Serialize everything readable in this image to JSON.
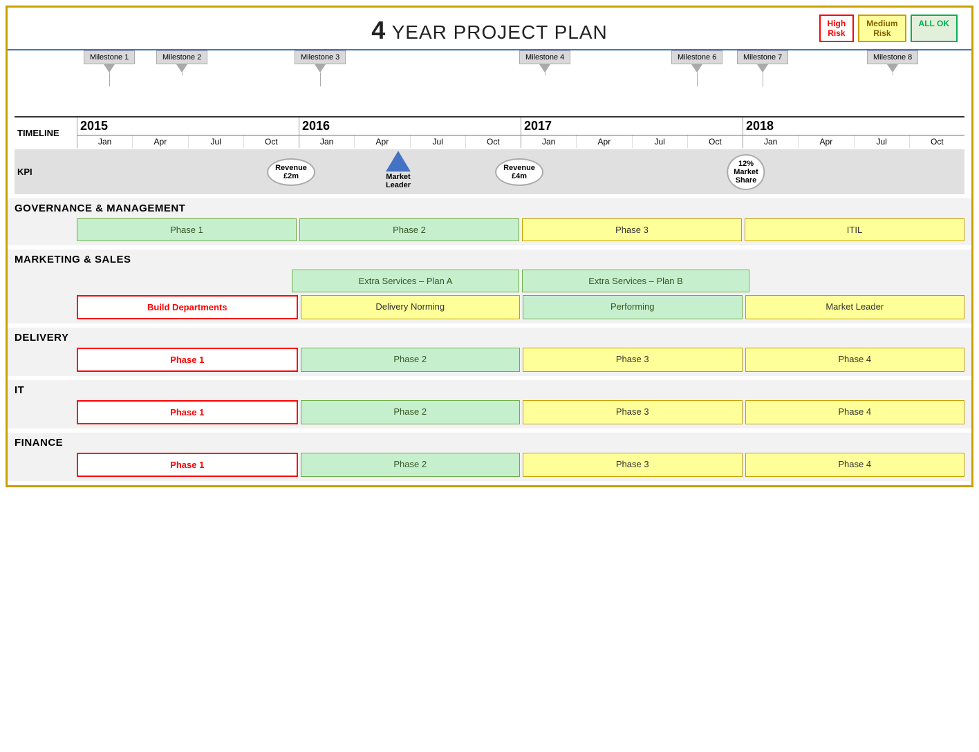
{
  "header": {
    "number": "4",
    "title": "YEAR PROJECT PLAN",
    "badges": {
      "high_risk": "High\nRisk",
      "medium_risk": "Medium\nRisk",
      "all_ok": "ALL OK"
    }
  },
  "years": [
    {
      "label": "2015",
      "months": [
        "Jan",
        "Apr",
        "Jul",
        "Oct"
      ]
    },
    {
      "label": "2016",
      "months": [
        "Jan",
        "Apr",
        "Jul",
        "Oct"
      ]
    },
    {
      "label": "2017",
      "months": [
        "Jan",
        "Apr",
        "Jul",
        "Oct"
      ]
    },
    {
      "label": "2018",
      "months": [
        "Jan",
        "Apr",
        "Jul",
        "Oct"
      ]
    }
  ],
  "milestones": [
    {
      "label": "Milestone  1",
      "yearIndex": 0,
      "quarterOffset": 0
    },
    {
      "label": "Milestone  2",
      "yearIndex": 0,
      "quarterOffset": 1
    },
    {
      "label": "Milestone  3",
      "yearIndex": 1,
      "quarterOffset": 0
    },
    {
      "label": "Milestone  4",
      "yearIndex": 2,
      "quarterOffset": 1
    },
    {
      "label": "Milestone  6",
      "yearIndex": 3,
      "quarterOffset": 0
    },
    {
      "label": "Milestone  7",
      "yearIndex": 3,
      "quarterOffset": 1
    },
    {
      "label": "Milestone  8",
      "yearIndex": 3,
      "quarterOffset": 3
    }
  ],
  "timeline_label": "TIMELINE",
  "kpi_label": "KPI",
  "kpis": [
    {
      "label": "Revenue\n£2m",
      "yearIndex": 1,
      "quarterOffset": 0.3
    },
    {
      "label": "Market\nLeader",
      "yearIndex": 1,
      "quarterOffset": 2,
      "type": "triangle"
    },
    {
      "label": "Revenue\n£4m",
      "yearIndex": 2,
      "quarterOffset": 0.3
    },
    {
      "label": "12%\nMarket\nShare",
      "yearIndex": 3,
      "quarterOffset": 0.3
    }
  ],
  "categories": [
    {
      "title": "GOVERNANCE  & MANAGEMENT",
      "rows": [
        [
          {
            "label": "Phase 1",
            "style": "green"
          },
          {
            "label": "Phase 2",
            "style": "green"
          },
          {
            "label": "Phase 3",
            "style": "yellow"
          },
          {
            "label": "ITIL",
            "style": "yellow"
          }
        ]
      ]
    },
    {
      "title": "MARKETING  & SALES",
      "rows": [
        [
          {
            "label": "",
            "style": "empty"
          },
          {
            "label": "Extra Services – Plan A",
            "style": "green"
          },
          {
            "label": "Extra Services – Plan B",
            "style": "green"
          },
          {
            "label": "",
            "style": "empty",
            "rowspan": 2
          }
        ],
        [
          {
            "label": "Build Departments",
            "style": "red-outline"
          },
          {
            "label": "Delivery Norming",
            "style": "yellow"
          },
          {
            "label": "Performing",
            "style": "green"
          },
          {
            "label": "Market Leader",
            "style": "yellow",
            "merged": true
          }
        ]
      ]
    },
    {
      "title": "DELIVERY",
      "rows": [
        [
          {
            "label": "Phase 1",
            "style": "red-outline"
          },
          {
            "label": "Phase 2",
            "style": "green"
          },
          {
            "label": "Phase 3",
            "style": "yellow"
          },
          {
            "label": "Phase 4",
            "style": "yellow"
          }
        ]
      ]
    },
    {
      "title": "IT",
      "rows": [
        [
          {
            "label": "Phase 1",
            "style": "red-outline"
          },
          {
            "label": "Phase 2",
            "style": "green"
          },
          {
            "label": "Phase 3",
            "style": "yellow"
          },
          {
            "label": "Phase 4",
            "style": "yellow"
          }
        ]
      ]
    },
    {
      "title": "FINANCE",
      "rows": [
        [
          {
            "label": "Phase 1",
            "style": "red-outline"
          },
          {
            "label": "Phase 2",
            "style": "green"
          },
          {
            "label": "Phase 3",
            "style": "yellow"
          },
          {
            "label": "Phase 4",
            "style": "yellow"
          }
        ]
      ]
    }
  ]
}
